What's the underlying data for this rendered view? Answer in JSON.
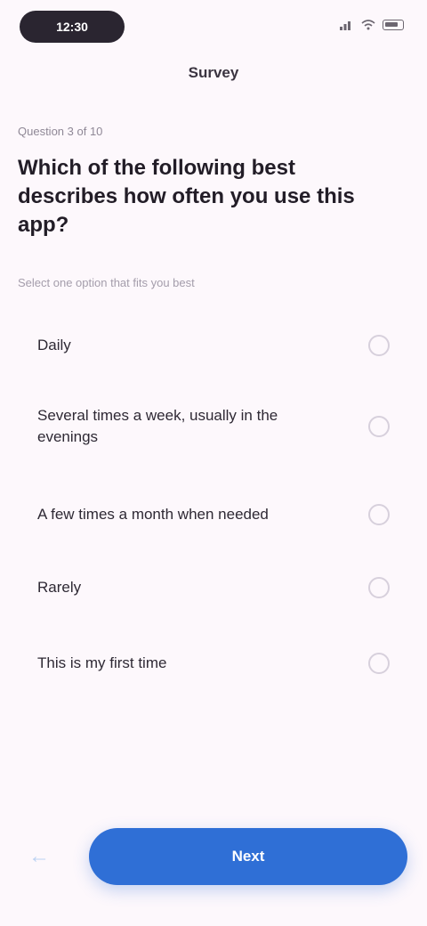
{
  "status_bar": {
    "time": "12:30"
  },
  "header": {
    "title": "Survey"
  },
  "question": {
    "step": "Question 3 of 10",
    "text": "Which of the following best describes how often you use this app?",
    "helper": "Select one option that fits you best"
  },
  "options": [
    {
      "label": "Daily",
      "height": 70
    },
    {
      "label": "Several times a week, usually in the evenings",
      "height": 112
    },
    {
      "label": "A few times a month when needed",
      "height": 86
    },
    {
      "label": "Rarely",
      "height": 78
    },
    {
      "label": "This is my first time",
      "height": 92
    }
  ],
  "footer": {
    "next_label": "Next"
  },
  "colors": {
    "accent": "#2f6fd6",
    "background": "#fdf8fc"
  }
}
